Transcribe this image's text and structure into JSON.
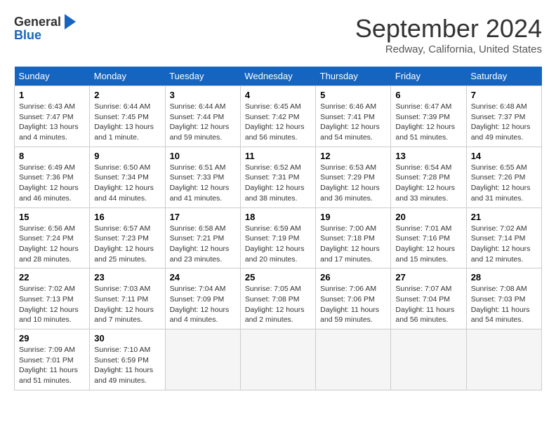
{
  "header": {
    "logo_line1": "General",
    "logo_line2": "Blue",
    "month": "September 2024",
    "location": "Redway, California, United States"
  },
  "days_of_week": [
    "Sunday",
    "Monday",
    "Tuesday",
    "Wednesday",
    "Thursday",
    "Friday",
    "Saturday"
  ],
  "weeks": [
    [
      {
        "day": 1,
        "sunrise": "Sunrise: 6:43 AM",
        "sunset": "Sunset: 7:47 PM",
        "daylight": "Daylight: 13 hours and 4 minutes."
      },
      {
        "day": 2,
        "sunrise": "Sunrise: 6:44 AM",
        "sunset": "Sunset: 7:45 PM",
        "daylight": "Daylight: 13 hours and 1 minute."
      },
      {
        "day": 3,
        "sunrise": "Sunrise: 6:44 AM",
        "sunset": "Sunset: 7:44 PM",
        "daylight": "Daylight: 12 hours and 59 minutes."
      },
      {
        "day": 4,
        "sunrise": "Sunrise: 6:45 AM",
        "sunset": "Sunset: 7:42 PM",
        "daylight": "Daylight: 12 hours and 56 minutes."
      },
      {
        "day": 5,
        "sunrise": "Sunrise: 6:46 AM",
        "sunset": "Sunset: 7:41 PM",
        "daylight": "Daylight: 12 hours and 54 minutes."
      },
      {
        "day": 6,
        "sunrise": "Sunrise: 6:47 AM",
        "sunset": "Sunset: 7:39 PM",
        "daylight": "Daylight: 12 hours and 51 minutes."
      },
      {
        "day": 7,
        "sunrise": "Sunrise: 6:48 AM",
        "sunset": "Sunset: 7:37 PM",
        "daylight": "Daylight: 12 hours and 49 minutes."
      }
    ],
    [
      {
        "day": 8,
        "sunrise": "Sunrise: 6:49 AM",
        "sunset": "Sunset: 7:36 PM",
        "daylight": "Daylight: 12 hours and 46 minutes."
      },
      {
        "day": 9,
        "sunrise": "Sunrise: 6:50 AM",
        "sunset": "Sunset: 7:34 PM",
        "daylight": "Daylight: 12 hours and 44 minutes."
      },
      {
        "day": 10,
        "sunrise": "Sunrise: 6:51 AM",
        "sunset": "Sunset: 7:33 PM",
        "daylight": "Daylight: 12 hours and 41 minutes."
      },
      {
        "day": 11,
        "sunrise": "Sunrise: 6:52 AM",
        "sunset": "Sunset: 7:31 PM",
        "daylight": "Daylight: 12 hours and 38 minutes."
      },
      {
        "day": 12,
        "sunrise": "Sunrise: 6:53 AM",
        "sunset": "Sunset: 7:29 PM",
        "daylight": "Daylight: 12 hours and 36 minutes."
      },
      {
        "day": 13,
        "sunrise": "Sunrise: 6:54 AM",
        "sunset": "Sunset: 7:28 PM",
        "daylight": "Daylight: 12 hours and 33 minutes."
      },
      {
        "day": 14,
        "sunrise": "Sunrise: 6:55 AM",
        "sunset": "Sunset: 7:26 PM",
        "daylight": "Daylight: 12 hours and 31 minutes."
      }
    ],
    [
      {
        "day": 15,
        "sunrise": "Sunrise: 6:56 AM",
        "sunset": "Sunset: 7:24 PM",
        "daylight": "Daylight: 12 hours and 28 minutes."
      },
      {
        "day": 16,
        "sunrise": "Sunrise: 6:57 AM",
        "sunset": "Sunset: 7:23 PM",
        "daylight": "Daylight: 12 hours and 25 minutes."
      },
      {
        "day": 17,
        "sunrise": "Sunrise: 6:58 AM",
        "sunset": "Sunset: 7:21 PM",
        "daylight": "Daylight: 12 hours and 23 minutes."
      },
      {
        "day": 18,
        "sunrise": "Sunrise: 6:59 AM",
        "sunset": "Sunset: 7:19 PM",
        "daylight": "Daylight: 12 hours and 20 minutes."
      },
      {
        "day": 19,
        "sunrise": "Sunrise: 7:00 AM",
        "sunset": "Sunset: 7:18 PM",
        "daylight": "Daylight: 12 hours and 17 minutes."
      },
      {
        "day": 20,
        "sunrise": "Sunrise: 7:01 AM",
        "sunset": "Sunset: 7:16 PM",
        "daylight": "Daylight: 12 hours and 15 minutes."
      },
      {
        "day": 21,
        "sunrise": "Sunrise: 7:02 AM",
        "sunset": "Sunset: 7:14 PM",
        "daylight": "Daylight: 12 hours and 12 minutes."
      }
    ],
    [
      {
        "day": 22,
        "sunrise": "Sunrise: 7:02 AM",
        "sunset": "Sunset: 7:13 PM",
        "daylight": "Daylight: 12 hours and 10 minutes."
      },
      {
        "day": 23,
        "sunrise": "Sunrise: 7:03 AM",
        "sunset": "Sunset: 7:11 PM",
        "daylight": "Daylight: 12 hours and 7 minutes."
      },
      {
        "day": 24,
        "sunrise": "Sunrise: 7:04 AM",
        "sunset": "Sunset: 7:09 PM",
        "daylight": "Daylight: 12 hours and 4 minutes."
      },
      {
        "day": 25,
        "sunrise": "Sunrise: 7:05 AM",
        "sunset": "Sunset: 7:08 PM",
        "daylight": "Daylight: 12 hours and 2 minutes."
      },
      {
        "day": 26,
        "sunrise": "Sunrise: 7:06 AM",
        "sunset": "Sunset: 7:06 PM",
        "daylight": "Daylight: 11 hours and 59 minutes."
      },
      {
        "day": 27,
        "sunrise": "Sunrise: 7:07 AM",
        "sunset": "Sunset: 7:04 PM",
        "daylight": "Daylight: 11 hours and 56 minutes."
      },
      {
        "day": 28,
        "sunrise": "Sunrise: 7:08 AM",
        "sunset": "Sunset: 7:03 PM",
        "daylight": "Daylight: 11 hours and 54 minutes."
      }
    ],
    [
      {
        "day": 29,
        "sunrise": "Sunrise: 7:09 AM",
        "sunset": "Sunset: 7:01 PM",
        "daylight": "Daylight: 11 hours and 51 minutes."
      },
      {
        "day": 30,
        "sunrise": "Sunrise: 7:10 AM",
        "sunset": "Sunset: 6:59 PM",
        "daylight": "Daylight: 11 hours and 49 minutes."
      },
      null,
      null,
      null,
      null,
      null
    ]
  ]
}
